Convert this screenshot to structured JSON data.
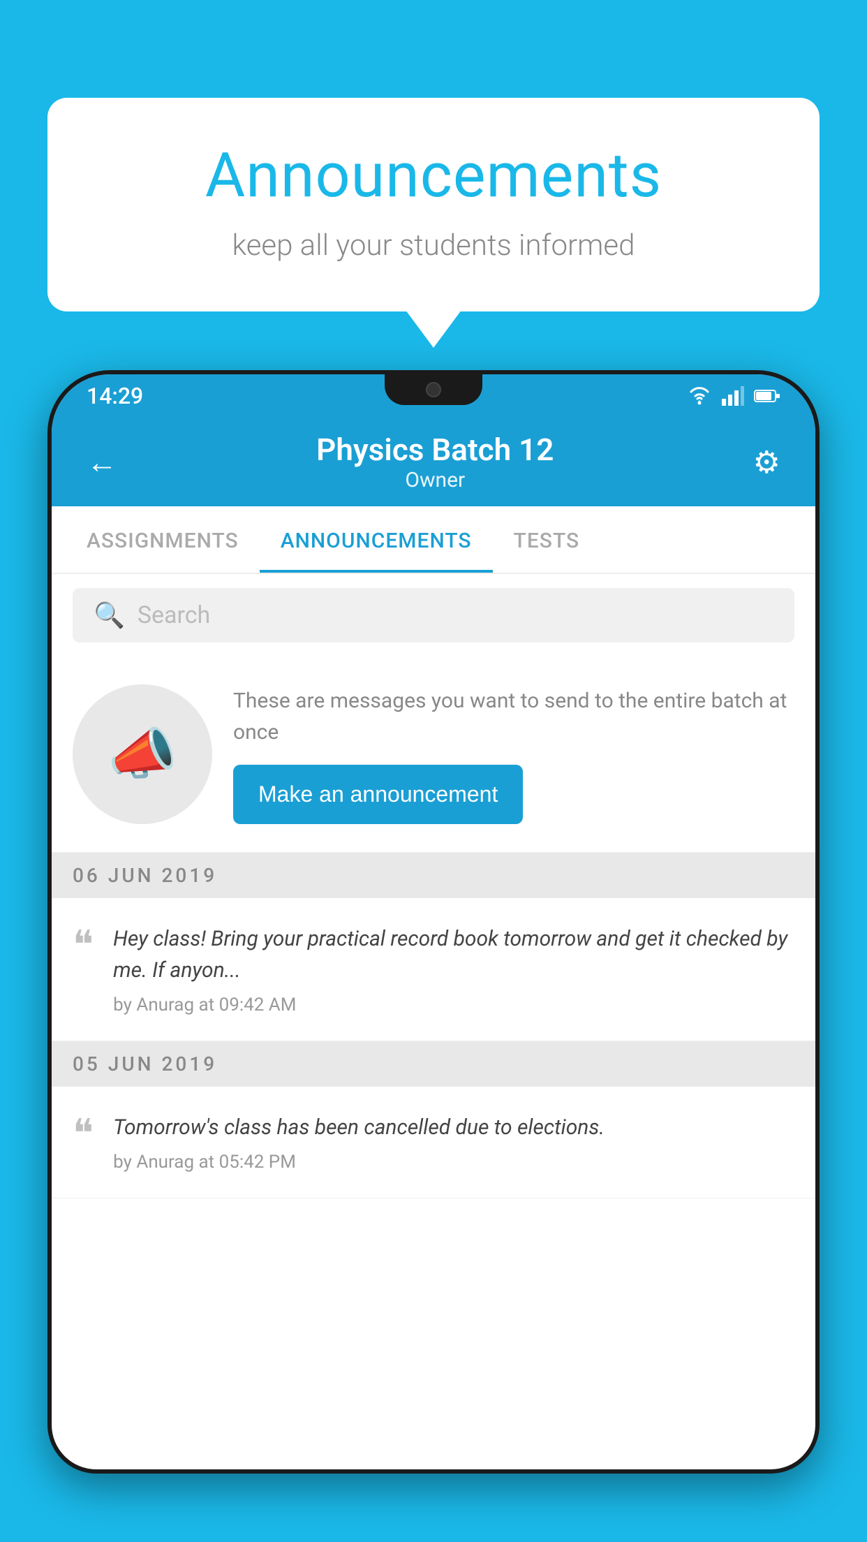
{
  "background_color": "#1ab8e8",
  "speech_bubble": {
    "title": "Announcements",
    "subtitle": "keep all your students informed"
  },
  "status_bar": {
    "time": "14:29"
  },
  "app_header": {
    "title": "Physics Batch 12",
    "subtitle": "Owner",
    "back_label": "←"
  },
  "tabs": [
    {
      "label": "ASSIGNMENTS",
      "active": false
    },
    {
      "label": "ANNOUNCEMENTS",
      "active": true
    },
    {
      "label": "TESTS",
      "active": false
    }
  ],
  "search": {
    "placeholder": "Search"
  },
  "promo": {
    "description": "These are messages you want to send to the entire batch at once",
    "button_label": "Make an announcement"
  },
  "announcements": [
    {
      "date": "06  JUN  2019",
      "text": "Hey class! Bring your practical record book tomorrow and get it checked by me. If anyon...",
      "meta": "by Anurag at 09:42 AM"
    },
    {
      "date": "05  JUN  2019",
      "text": "Tomorrow's class has been cancelled due to elections.",
      "meta": "by Anurag at 05:42 PM"
    }
  ]
}
